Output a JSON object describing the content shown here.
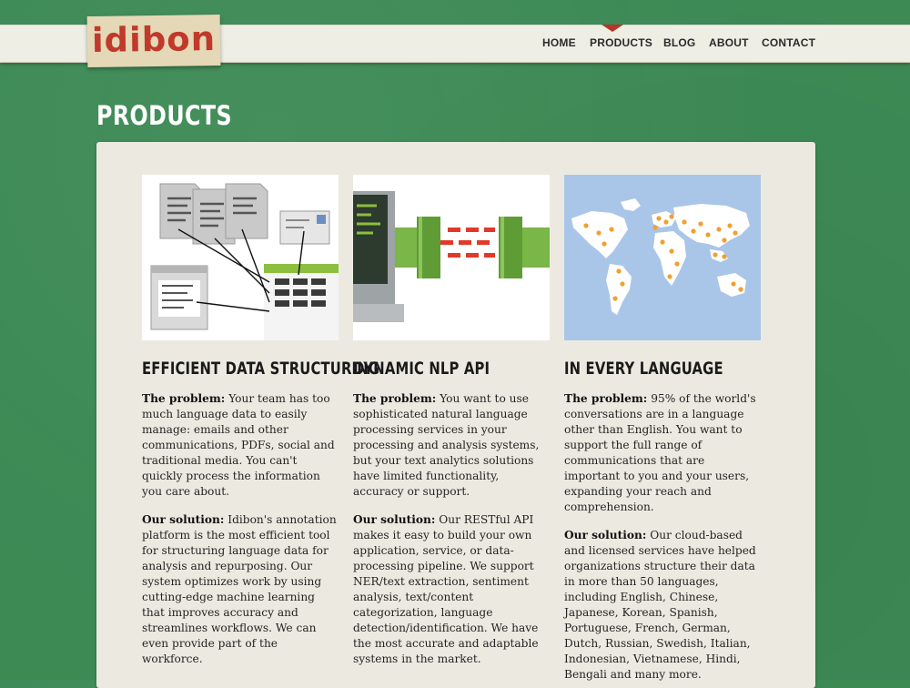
{
  "brand": {
    "logo_text": "idibon",
    "logo_color": "#c0392b"
  },
  "nav": {
    "items": [
      {
        "label": "HOME"
      },
      {
        "label": "PRODUCTS",
        "active": true
      },
      {
        "label": "BLOG"
      },
      {
        "label": "ABOUT"
      },
      {
        "label": "CONTACT"
      }
    ]
  },
  "page": {
    "title": "PRODUCTS"
  },
  "colors": {
    "background": "#3d8a55",
    "panel": "#eceae0",
    "accent": "#b8352a",
    "map_ocean": "#a9c6e8",
    "map_dot": "#f0a030",
    "bar_green": "#7ab648"
  },
  "products": [
    {
      "illustration": "document-structuring-illustration",
      "title": "EFFICIENT DATA STRUCTURING",
      "problem_label": "The problem:",
      "problem_text": "Your team has too much language data to easily manage: emails and other communications, PDFs, social and traditional media. You can't quickly process the information you care about.",
      "solution_label": "Our solution:",
      "solution_text": "Idibon's annotation platform is the most efficient tool for structuring language data for analysis and repurposing. Our system optimizes work by using cutting-edge machine learning that improves accuracy and streamlines workflows. We can even provide part of the workforce."
    },
    {
      "illustration": "nlp-api-pipe-illustration",
      "title": "DYNAMIC NLP API",
      "problem_label": "The problem:",
      "problem_text": "You want to use sophisticated natural language processing services in your processing and analysis systems, but your text analytics solutions have limited functionality, accuracy or support.",
      "solution_label": "Our solution:",
      "solution_text": "Our RESTful API makes it easy to build your own application, service, or data-processing pipeline. We support NER/text extraction, sentiment analysis, text/content categorization, language detection/identification. We have the most accurate and adaptable systems in the market."
    },
    {
      "illustration": "world-map-illustration",
      "title": "IN EVERY LANGUAGE",
      "problem_label": "The problem:",
      "problem_text": "95% of the world's conversations are in a language other than English. You want to support the full range of communications that are important to you and your users, expanding your reach and comprehension.",
      "solution_label": "Our solution:",
      "solution_text": "Our cloud-based and licensed services have helped organizations structure their data in more than 50 languages, including English, Chinese, Japanese, Korean, Spanish, Portuguese, French, German, Dutch, Russian, Swedish, Italian, Indonesian, Vietnamese, Hindi, Bengali and many more."
    }
  ]
}
